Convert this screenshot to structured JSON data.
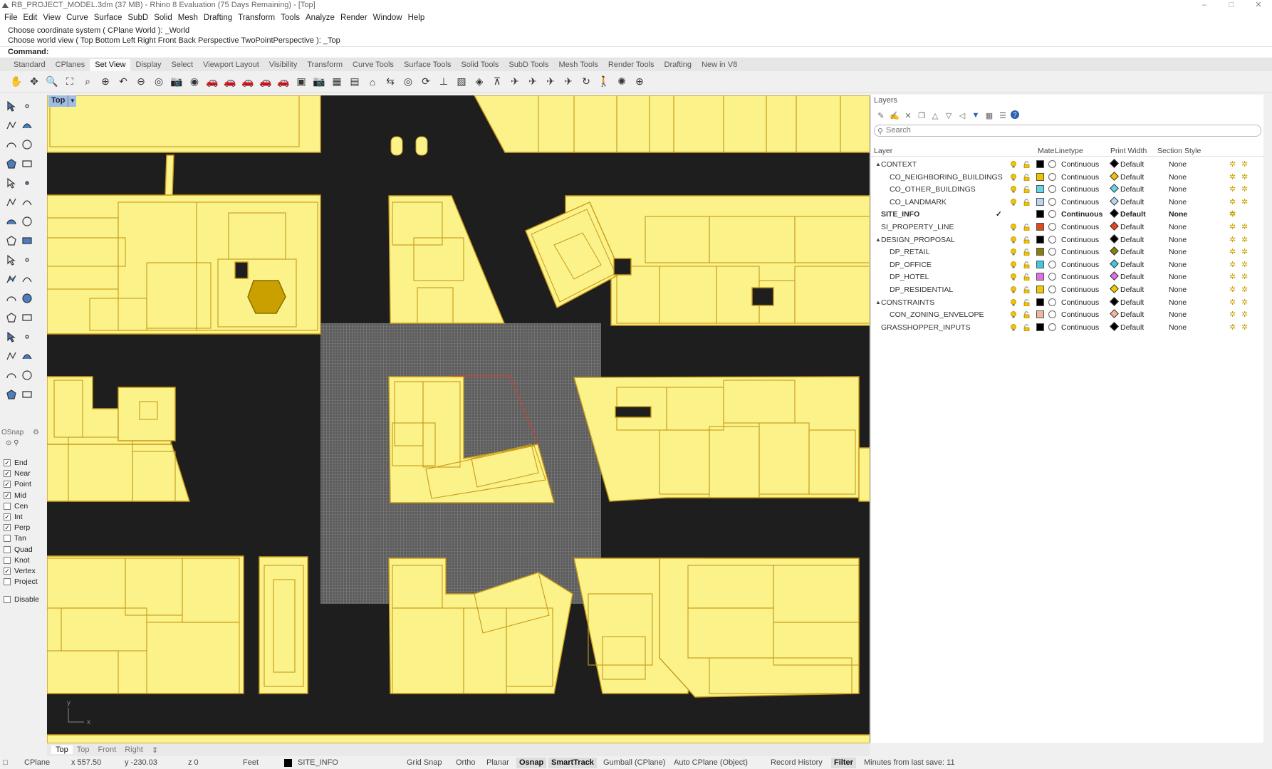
{
  "window": {
    "title": "RB_PROJECT_MODEL.3dm (37 MB) - Rhino 8 Evaluation (75 Days Remaining) - [Top]"
  },
  "menu": [
    "File",
    "Edit",
    "View",
    "Curve",
    "Surface",
    "SubD",
    "Solid",
    "Mesh",
    "Drafting",
    "Transform",
    "Tools",
    "Analyze",
    "Render",
    "Window",
    "Help"
  ],
  "command": {
    "history": [
      "Choose coordinate system ( CPlane  World ): _World",
      "Choose world view ( Top  Bottom  Left  Right  Front  Back  Perspective  TwoPointPerspective ): _Top"
    ],
    "prompt": "Command:"
  },
  "tabs": [
    {
      "label": "Standard"
    },
    {
      "label": "CPlanes"
    },
    {
      "label": "Set View",
      "active": true
    },
    {
      "label": "Display"
    },
    {
      "label": "Select"
    },
    {
      "label": "Viewport Layout"
    },
    {
      "label": "Visibility"
    },
    {
      "label": "Transform"
    },
    {
      "label": "Curve Tools"
    },
    {
      "label": "Surface Tools"
    },
    {
      "label": "Solid Tools"
    },
    {
      "label": "SubD Tools"
    },
    {
      "label": "Mesh Tools"
    },
    {
      "label": "Render Tools"
    },
    {
      "label": "Drafting"
    },
    {
      "label": "New in V8"
    }
  ],
  "toolbar_icons": [
    "pan-icon",
    "rotate-view-icon",
    "zoom-icon",
    "zoom-extents-icon",
    "zoom-window-icon",
    "zoom-selected-icon",
    "undo-view-icon",
    "zoom-out-icon",
    "zoom-all-icon",
    "camera-icon",
    "lens-icon",
    "car-icon",
    "car-icon",
    "car-icon",
    "car-icon",
    "car-icon",
    "named-view-icon",
    "camera-icon",
    "viewport-icon",
    "save-view-icon",
    "place-camera-icon",
    "match-view-icon",
    "target-icon",
    "rotate-icon",
    "two-point-icon",
    "box-view-icon",
    "cube-view-icon",
    "perspective-icon",
    "plane-icon",
    "plane-icon",
    "plane-icon",
    "plane-icon",
    "orbit-360-icon",
    "walk-icon",
    "sun-icon",
    "crosshair-icon"
  ],
  "viewport": {
    "name": "Top",
    "tabs": [
      {
        "label": "Top",
        "active": true
      },
      {
        "label": "Top"
      },
      {
        "label": "Front"
      },
      {
        "label": "Right"
      }
    ],
    "axis_x": "x",
    "axis_y": "y"
  },
  "osnap": {
    "title": "OSnap",
    "items": [
      {
        "label": "End",
        "checked": true
      },
      {
        "label": "Near",
        "checked": true
      },
      {
        "label": "Point",
        "checked": true
      },
      {
        "label": "Mid",
        "checked": true
      },
      {
        "label": "Cen",
        "checked": false
      },
      {
        "label": "Int",
        "checked": true
      },
      {
        "label": "Perp",
        "checked": true
      },
      {
        "label": "Tan",
        "checked": false
      },
      {
        "label": "Quad",
        "checked": false
      },
      {
        "label": "Knot",
        "checked": false
      },
      {
        "label": "Vertex",
        "checked": true
      },
      {
        "label": "Project",
        "checked": false
      }
    ],
    "disable": "Disable"
  },
  "layers": {
    "title": "Layers",
    "search_placeholder": "Search",
    "columns": {
      "layer": "Layer",
      "material": "Mate",
      "linetype": "Linetype",
      "print_width": "Print Width",
      "section_style": "Section Style"
    },
    "rows": [
      {
        "name": "CONTEXT",
        "indent": 0,
        "expand": "◢",
        "color": "#000000",
        "linetype": "Continuous",
        "print": "Default",
        "print_color": "#000000",
        "section": "None"
      },
      {
        "name": "CO_NEIGHBORING_BUILDINGS",
        "indent": 1,
        "color": "#f2c200",
        "linetype": "Continuous",
        "print": "Default",
        "print_color": "#f2c200",
        "section": "None"
      },
      {
        "name": "CO_OTHER_BUILDINGS",
        "indent": 1,
        "color": "#66d4e8",
        "linetype": "Continuous",
        "print": "Default",
        "print_color": "#66d4e8",
        "section": "None"
      },
      {
        "name": "CO_LANDMARK",
        "indent": 1,
        "color": "#b8d6f0",
        "linetype": "Continuous",
        "print": "Default",
        "print_color": "#b8d6f0",
        "section": "None"
      },
      {
        "name": "SITE_INFO",
        "indent": 0,
        "current": true,
        "color": "#000000",
        "linetype": "Continuous",
        "print": "Default",
        "print_color": "#000000",
        "section": "None"
      },
      {
        "name": "SI_PROPERTY_LINE",
        "indent": 0,
        "color": "#e04a1a",
        "linetype": "Continuous",
        "print": "Default",
        "print_color": "#e04a1a",
        "section": "None"
      },
      {
        "name": "DESIGN_PROPOSAL",
        "indent": 0,
        "expand": "◢",
        "color": "#000000",
        "linetype": "Continuous",
        "print": "Default",
        "print_color": "#000000",
        "section": "None"
      },
      {
        "name": "DP_RETAIL",
        "indent": 1,
        "color": "#8a7e10",
        "linetype": "Continuous",
        "print": "Default",
        "print_color": "#8a7e10",
        "section": "None"
      },
      {
        "name": "DP_OFFICE",
        "indent": 1,
        "color": "#40c8e0",
        "linetype": "Continuous",
        "print": "Default",
        "print_color": "#40c8e0",
        "section": "None"
      },
      {
        "name": "DP_HOTEL",
        "indent": 1,
        "color": "#e070e0",
        "linetype": "Continuous",
        "print": "Default",
        "print_color": "#e070e0",
        "section": "None"
      },
      {
        "name": "DP_RESIDENTIAL",
        "indent": 1,
        "color": "#f4c800",
        "linetype": "Continuous",
        "print": "Default",
        "print_color": "#f4c800",
        "section": "None"
      },
      {
        "name": "CONSTRAINTS",
        "indent": 0,
        "expand": "◢",
        "color": "#000000",
        "linetype": "Continuous",
        "print": "Default",
        "print_color": "#000000",
        "section": "None"
      },
      {
        "name": "CON_ZONING_ENVELOPE",
        "indent": 1,
        "color": "#f0b89a",
        "linetype": "Continuous",
        "print": "Default",
        "print_color": "#f0b89a",
        "section": "None"
      },
      {
        "name": "GRASSHOPPER_INPUTS",
        "indent": 0,
        "color": "#000000",
        "linetype": "Continuous",
        "print": "Default",
        "print_color": "#000000",
        "section": "None"
      }
    ]
  },
  "status": {
    "cplane": "CPlane",
    "x": "x 557.50",
    "y": "y -230.03",
    "z": "z 0",
    "units": "Feet",
    "layer": "SITE_INFO",
    "toggles": [
      {
        "label": "Grid Snap",
        "on": false
      },
      {
        "label": "Ortho",
        "on": false
      },
      {
        "label": "Planar",
        "on": false
      },
      {
        "label": "Osnap",
        "on": true
      },
      {
        "label": "SmartTrack",
        "on": true
      },
      {
        "label": "Gumball (CPlane)",
        "on": false
      },
      {
        "label": "Auto CPlane (Object)",
        "on": false
      },
      {
        "label": "Record History",
        "on": false
      },
      {
        "label": "Filter",
        "on": true
      }
    ],
    "save_info": "Minutes from last save: 11"
  },
  "colors": {
    "building_fill": "#fbf28a",
    "building_edge": "#c89a18",
    "ground": "#1e1e1e",
    "property_line": "#d0402a",
    "site_grid": "#8e8e8e",
    "viewport_label": "#9dbde6"
  }
}
